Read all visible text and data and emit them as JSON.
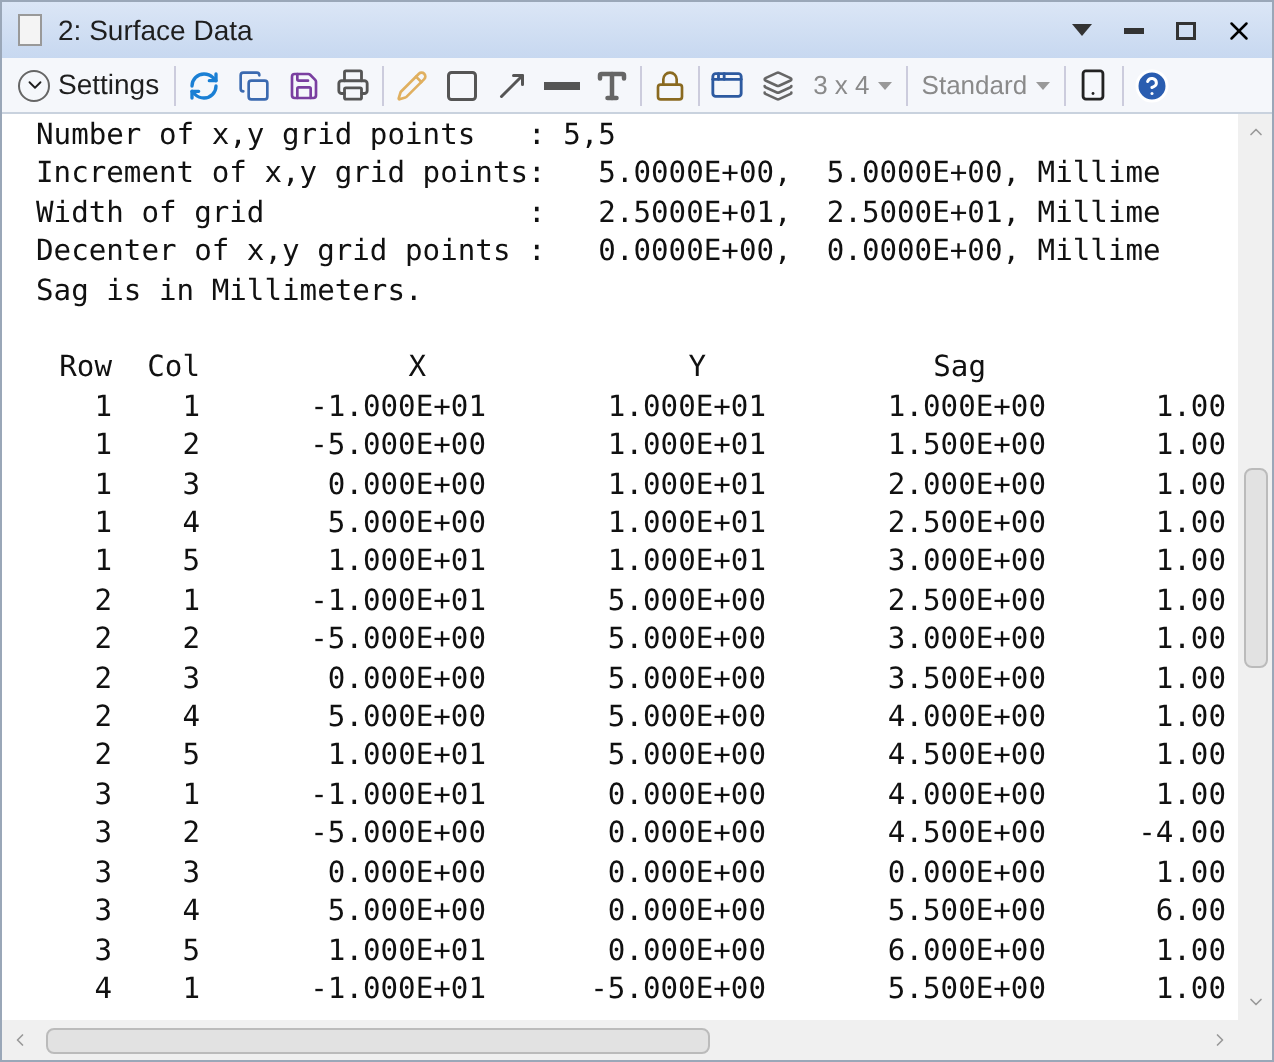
{
  "window": {
    "title": "2: Surface Data"
  },
  "toolbar": {
    "settings": "Settings",
    "layout": "3 x 4",
    "style": "Standard"
  },
  "header_lines": [
    "Number of x,y grid points   : 5,5",
    "Increment of x,y grid points:   5.0000E+00,  5.0000E+00, Millime",
    "Width of grid               :   2.5000E+01,  2.5000E+01, Millime",
    "Decenter of x,y grid points :   0.0000E+00,  0.0000E+00, Millime",
    "Sag is in Millimeters."
  ],
  "table": {
    "columns": [
      "Row",
      "Col",
      "X",
      "Y",
      "Sag"
    ],
    "rows": [
      [
        "1",
        "1",
        "-1.000E+01",
        "1.000E+01",
        "1.000E+00",
        "1.00"
      ],
      [
        "1",
        "2",
        "-5.000E+00",
        "1.000E+01",
        "1.500E+00",
        "1.00"
      ],
      [
        "1",
        "3",
        "0.000E+00",
        "1.000E+01",
        "2.000E+00",
        "1.00"
      ],
      [
        "1",
        "4",
        "5.000E+00",
        "1.000E+01",
        "2.500E+00",
        "1.00"
      ],
      [
        "1",
        "5",
        "1.000E+01",
        "1.000E+01",
        "3.000E+00",
        "1.00"
      ],
      [
        "2",
        "1",
        "-1.000E+01",
        "5.000E+00",
        "2.500E+00",
        "1.00"
      ],
      [
        "2",
        "2",
        "-5.000E+00",
        "5.000E+00",
        "3.000E+00",
        "1.00"
      ],
      [
        "2",
        "3",
        "0.000E+00",
        "5.000E+00",
        "3.500E+00",
        "1.00"
      ],
      [
        "2",
        "4",
        "5.000E+00",
        "5.000E+00",
        "4.000E+00",
        "1.00"
      ],
      [
        "2",
        "5",
        "1.000E+01",
        "5.000E+00",
        "4.500E+00",
        "1.00"
      ],
      [
        "3",
        "1",
        "-1.000E+01",
        "0.000E+00",
        "4.000E+00",
        "1.00"
      ],
      [
        "3",
        "2",
        "-5.000E+00",
        "0.000E+00",
        "4.500E+00",
        "-4.00"
      ],
      [
        "3",
        "3",
        "0.000E+00",
        "0.000E+00",
        "0.000E+00",
        "1.00"
      ],
      [
        "3",
        "4",
        "5.000E+00",
        "0.000E+00",
        "5.500E+00",
        "6.00"
      ],
      [
        "3",
        "5",
        "1.000E+01",
        "0.000E+00",
        "6.000E+00",
        "1.00"
      ],
      [
        "4",
        "1",
        "-1.000E+01",
        "-5.000E+00",
        "5.500E+00",
        "1.00"
      ]
    ]
  }
}
